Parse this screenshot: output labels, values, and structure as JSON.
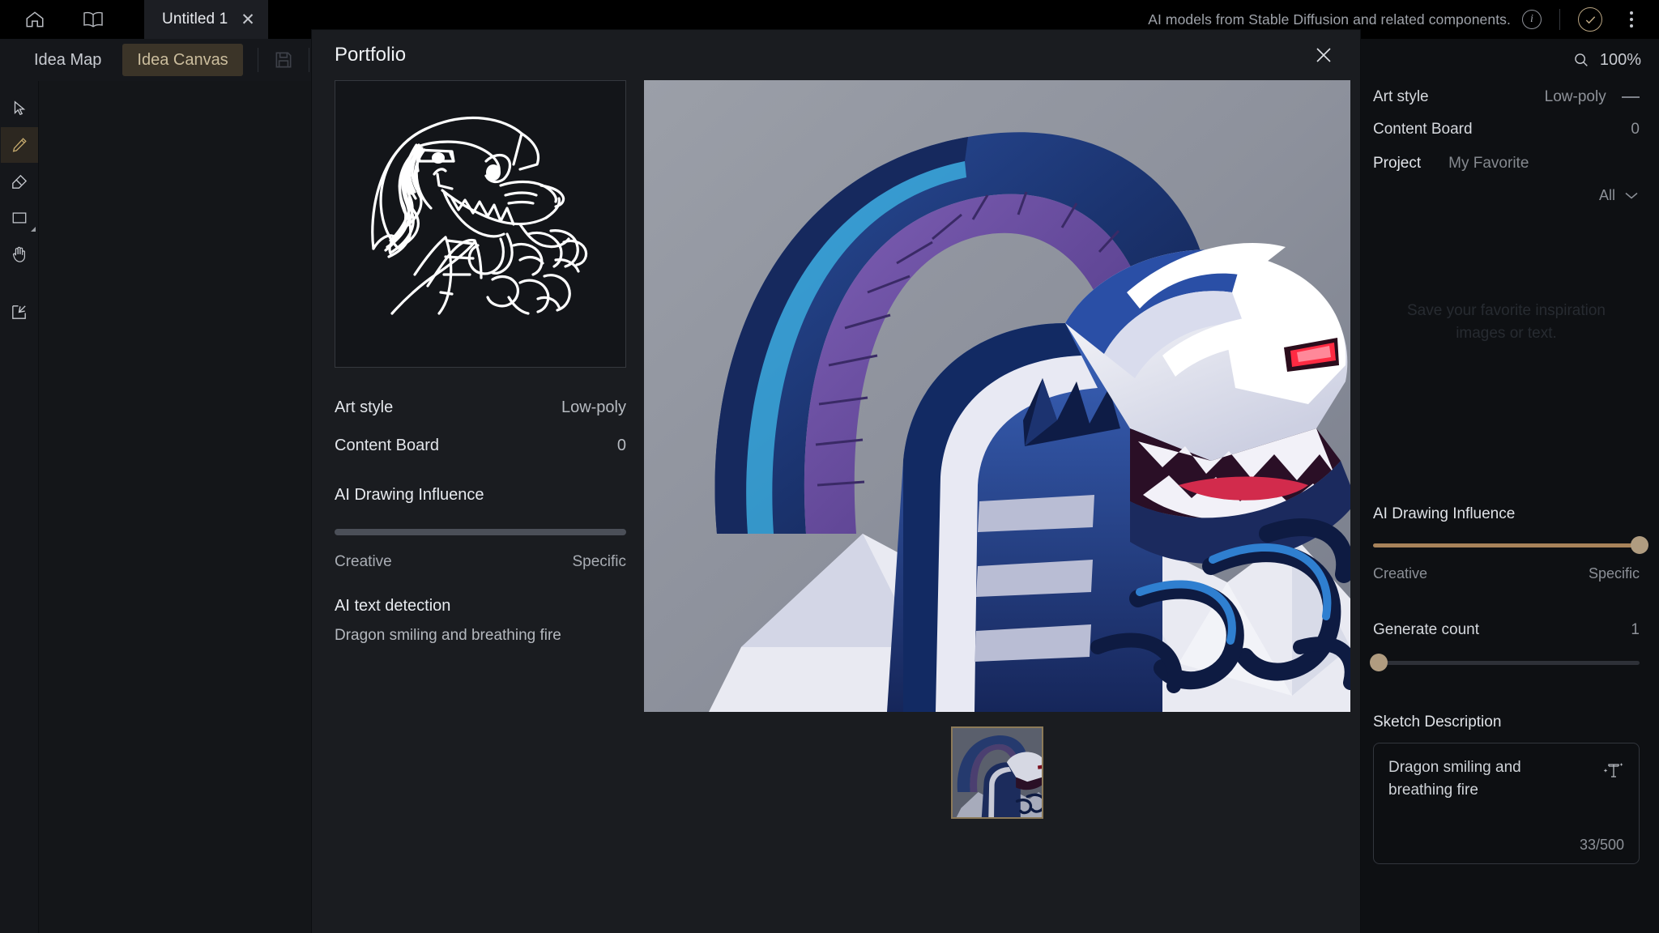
{
  "titlebar": {
    "home_icon": "home-icon",
    "book_icon": "book-icon",
    "tab_label": "Untitled 1",
    "tab_close": "✕",
    "note": "AI models from Stable Diffusion and related components.",
    "info_icon": "i",
    "check_icon": "check-icon",
    "more_icon": "more-vertical-icon"
  },
  "modebar": {
    "idea_map": "Idea Map",
    "idea_canvas": "Idea Canvas",
    "save_icon": "save-icon"
  },
  "tools": [
    {
      "name": "select-tool",
      "icon": "cursor-icon",
      "active": false
    },
    {
      "name": "pencil-tool",
      "icon": "pencil-icon",
      "active": true
    },
    {
      "name": "eraser-tool",
      "icon": "eraser-icon",
      "active": false
    },
    {
      "name": "shape-tool",
      "icon": "rectangle-icon",
      "active": false
    },
    {
      "name": "pan-tool",
      "icon": "hand-icon",
      "active": false
    },
    {
      "name": "export-tool",
      "icon": "export-icon",
      "active": false
    }
  ],
  "right_panel": {
    "zoom_label": "100%",
    "search_icon": "search-icon",
    "art_style_label": "Art style",
    "art_style_value": "Low-poly",
    "content_board_label": "Content Board",
    "content_board_value": "0",
    "tab_project": "Project",
    "tab_favorite": "My Favorite",
    "filter_value": "All",
    "filter_icon": "chevron-down-icon",
    "empty_text": "Save your favorite inspiration images or text.",
    "influence_label": "AI Drawing Influence",
    "influence_percent": 100,
    "influence_min_label": "Creative",
    "influence_max_label": "Specific",
    "generate_count_label": "Generate count",
    "generate_count_value": "1",
    "generate_count_percent": 2,
    "sketch_desc_label": "Sketch Description",
    "sketch_desc_value": "Dragon smiling and breathing fire",
    "sketch_desc_counter": "33/500",
    "sketch_desc_icon": "magic-text-icon",
    "accent_color": "#a8835a",
    "knob_color": "#b09c80"
  },
  "modal": {
    "title": "Portfolio",
    "close_icon": "close-icon",
    "sketch_alt": "dragon-sketch",
    "art_style_label": "Art style",
    "art_style_value": "Low-poly",
    "content_board_label": "Content Board",
    "content_board_value": "0",
    "influence_label": "AI Drawing Influence",
    "influence_min_label": "Creative",
    "influence_max_label": "Specific",
    "detection_label": "AI text detection",
    "detection_value": "Dragon smiling and breathing fire",
    "hero_alt": "generated-dragon-image",
    "thumb_alt": "generated-dragon-thumbnail"
  }
}
